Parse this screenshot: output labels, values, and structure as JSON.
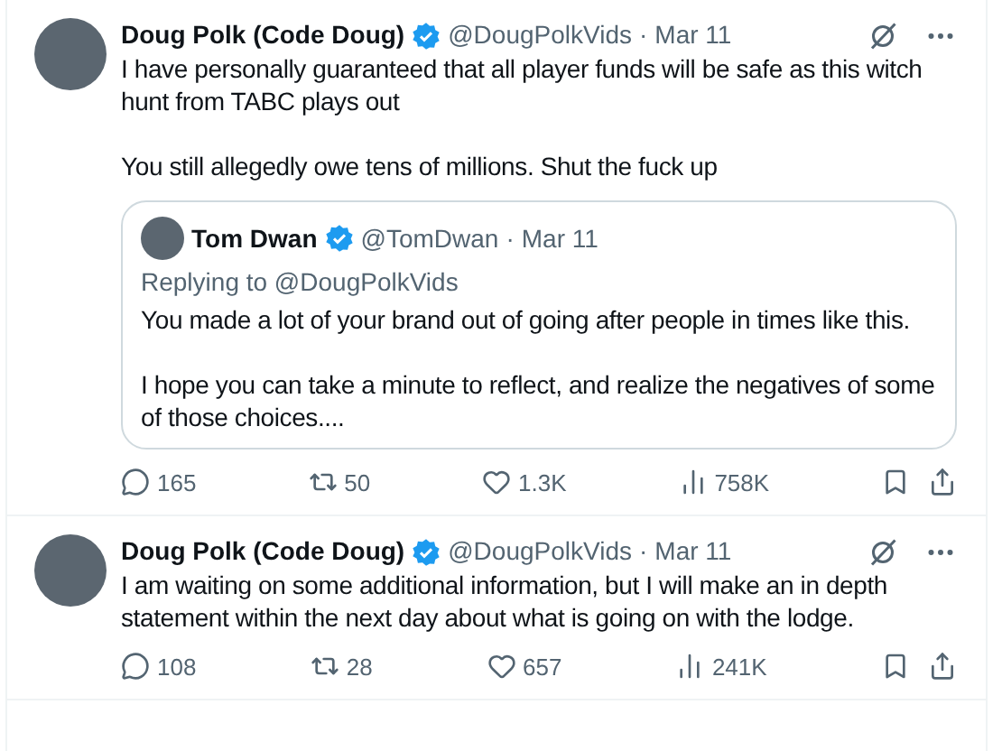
{
  "tweets": [
    {
      "name": "Doug Polk (Code Doug)",
      "verified": true,
      "handle": "@DougPolkVids",
      "dot": "·",
      "date": "Mar 11",
      "paragraphs": [
        "I have personally guaranteed that all player funds will be safe as this witch hunt from TABC plays out",
        "You still allegedly owe tens of millions. Shut the fuck up"
      ],
      "quote": {
        "name": "Tom Dwan",
        "verified": true,
        "handle": "@TomDwan",
        "dot": "·",
        "date": "Mar 11",
        "reply_to": "Replying to @DougPolkVids",
        "paragraphs": [
          "You made a lot of your brand out of going after people in times like this.",
          "I hope you can take a minute to reflect, and realize the negatives of some of those choices...."
        ]
      },
      "replies": "165",
      "reposts": "50",
      "likes": "1.3K",
      "views": "758K"
    },
    {
      "name": "Doug Polk (Code Doug)",
      "verified": true,
      "handle": "@DougPolkVids",
      "dot": "·",
      "date": "Mar 11",
      "paragraphs": [
        "I am waiting on some additional information, but I will make an in depth statement within the next day about what is going on with the lodge."
      ],
      "replies": "108",
      "reposts": "28",
      "likes": "657",
      "views": "241K"
    }
  ]
}
